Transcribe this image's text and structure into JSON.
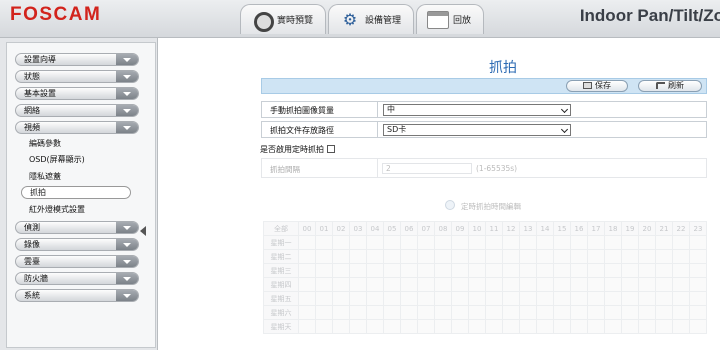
{
  "header": {
    "logo": "FOSCAM",
    "brand_title": "Indoor Pan/Tilt/Zo",
    "tabs": [
      {
        "label": "實時預覽",
        "icon": "camera-icon"
      },
      {
        "label": "設備管理",
        "icon": "gear-icon"
      },
      {
        "label": "回放",
        "icon": "calendar-icon"
      }
    ]
  },
  "sidebar": {
    "items": [
      {
        "label": "設置向導"
      },
      {
        "label": "狀態"
      },
      {
        "label": "基本設置"
      },
      {
        "label": "網絡"
      },
      {
        "label": "視頻"
      }
    ],
    "video_subitems": [
      {
        "label": "編碼參數"
      },
      {
        "label": "OSD(屏幕顯示)"
      },
      {
        "label": "隱私遮蓋"
      },
      {
        "label": "抓拍"
      },
      {
        "label": "紅外燈模式設置"
      }
    ],
    "items_after": [
      {
        "label": "偵測"
      },
      {
        "label": "錄像"
      },
      {
        "label": "雲臺"
      },
      {
        "label": "防火牆"
      },
      {
        "label": "系統"
      }
    ]
  },
  "main": {
    "title": "抓拍",
    "toolbar": {
      "save_label": "保存",
      "refresh_label": "刷新"
    },
    "fields": {
      "quality_label": "手動抓拍圖像質量",
      "quality_value": "中",
      "path_label": "抓拍文件存放路徑",
      "path_value": "SD卡"
    },
    "timed_enable_label": "是否啟用定時抓拍",
    "interval": {
      "label": "抓拍間隔",
      "value": "2",
      "hint": "(1-65535s)"
    },
    "schedule": {
      "title": "定時抓拍時間編輯",
      "corner_label": "全部",
      "hours": [
        "00",
        "01",
        "02",
        "03",
        "04",
        "05",
        "06",
        "07",
        "08",
        "09",
        "10",
        "11",
        "12",
        "13",
        "14",
        "15",
        "16",
        "17",
        "18",
        "19",
        "20",
        "21",
        "22",
        "23"
      ],
      "days": [
        "星期一",
        "星期二",
        "星期三",
        "星期四",
        "星期五",
        "星期六",
        "星期天"
      ]
    }
  },
  "colors": {
    "logo_red": "#d2231c",
    "title_blue": "#2d6bb3",
    "toolbar_bg": "#cfe4f4"
  }
}
